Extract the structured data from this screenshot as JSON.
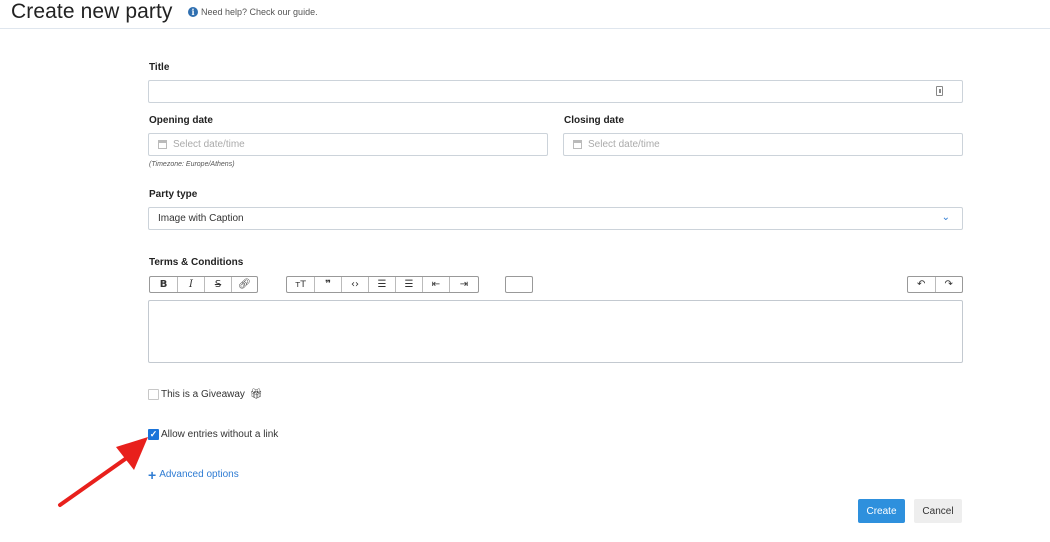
{
  "header": {
    "title": "Create new party",
    "help_text": "Need help? Check our guide."
  },
  "form": {
    "title_label": "Title",
    "opening_label": "Opening date",
    "opening_placeholder": "Select date/time",
    "timezone_hint": "(Timezone: Europe/Athens)",
    "closing_label": "Closing date",
    "closing_placeholder": "Select date/time",
    "party_type_label": "Party type",
    "party_type_value": "Image with Caption",
    "terms_label": "Terms & Conditions",
    "giveaway_label": "This is a Giveaway",
    "giveaway_checked": false,
    "allow_link_label": "Allow entries without a link",
    "allow_link_checked": true,
    "advanced_label": "Advanced options"
  },
  "toolbar": {
    "group1": [
      "B",
      "I",
      "S",
      "link"
    ],
    "group2": [
      "text-size",
      "quote",
      "code",
      "bullet-list",
      "numbered-list",
      "outdent",
      "indent"
    ],
    "undo_redo": [
      "undo",
      "redo"
    ]
  },
  "actions": {
    "create_label": "Create",
    "cancel_label": "Cancel"
  },
  "colors": {
    "accent": "#2e90dd",
    "arrow": "#e8201c"
  }
}
